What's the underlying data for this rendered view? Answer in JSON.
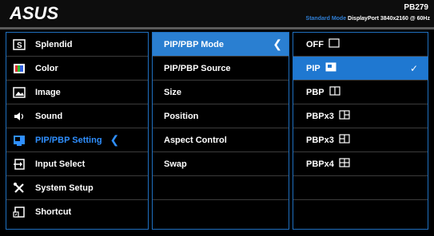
{
  "header": {
    "logo_text": "ASUS",
    "model": "PB279",
    "mode_label": "Standard Mode",
    "input_label": "DisplayPort 3840x2160 @ 60Hz"
  },
  "menu_main": {
    "items": [
      {
        "label": "Splendid",
        "icon": "splendid-icon"
      },
      {
        "label": "Color",
        "icon": "color-icon"
      },
      {
        "label": "Image",
        "icon": "image-icon"
      },
      {
        "label": "Sound",
        "icon": "speaker-icon"
      },
      {
        "label": "PIP/PBP Setting",
        "icon": "pip-icon",
        "selected": true
      },
      {
        "label": "Input Select",
        "icon": "input-icon"
      },
      {
        "label": "System Setup",
        "icon": "tools-icon"
      },
      {
        "label": "Shortcut",
        "icon": "shortcut-icon"
      }
    ]
  },
  "menu_sub": {
    "items": [
      {
        "label": "PIP/PBP Mode",
        "selected": true
      },
      {
        "label": "PIP/PBP Source"
      },
      {
        "label": "Size"
      },
      {
        "label": "Position"
      },
      {
        "label": "Aspect Control"
      },
      {
        "label": "Swap"
      },
      {
        "label": ""
      },
      {
        "label": ""
      }
    ]
  },
  "menu_options": {
    "items": [
      {
        "label": "OFF",
        "icon": "off-box-icon"
      },
      {
        "label": "PIP",
        "icon": "pip-box-icon",
        "selected": true
      },
      {
        "label": "PBP",
        "icon": "pbp-split-icon"
      },
      {
        "label": "PBPx3",
        "icon": "pbp3a-icon"
      },
      {
        "label": "PBPx3",
        "icon": "pbp3b-icon"
      },
      {
        "label": "PBPx4",
        "icon": "pbp4-icon"
      },
      {
        "label": ""
      },
      {
        "label": ""
      }
    ]
  },
  "colors": {
    "accent": "#2a7fd1",
    "border": "#1f6fbf",
    "highlight_text": "#2f8fff"
  }
}
